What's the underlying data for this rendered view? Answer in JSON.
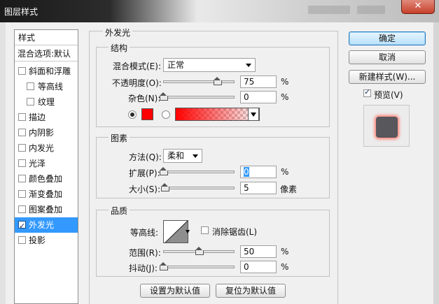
{
  "window": {
    "title": "图层样式",
    "close_label": "✕"
  },
  "style_list": {
    "header": "样式",
    "blend_default": "混合选项:默认",
    "items": [
      {
        "label": "斜面和浮雕",
        "checked": false,
        "indent": false,
        "selected": false
      },
      {
        "label": "等高线",
        "checked": false,
        "indent": true,
        "selected": false
      },
      {
        "label": "纹理",
        "checked": false,
        "indent": true,
        "selected": false
      },
      {
        "label": "描边",
        "checked": false,
        "indent": false,
        "selected": false
      },
      {
        "label": "内阴影",
        "checked": false,
        "indent": false,
        "selected": false
      },
      {
        "label": "内发光",
        "checked": false,
        "indent": false,
        "selected": false
      },
      {
        "label": "光泽",
        "checked": false,
        "indent": false,
        "selected": false
      },
      {
        "label": "颜色叠加",
        "checked": false,
        "indent": false,
        "selected": false
      },
      {
        "label": "渐变叠加",
        "checked": false,
        "indent": false,
        "selected": false
      },
      {
        "label": "图案叠加",
        "checked": false,
        "indent": false,
        "selected": false
      },
      {
        "label": "外发光",
        "checked": true,
        "indent": false,
        "selected": true
      },
      {
        "label": "投影",
        "checked": false,
        "indent": false,
        "selected": false
      }
    ]
  },
  "panel": {
    "title": "外发光",
    "structure": {
      "title": "结构",
      "blend_mode_label": "混合模式(E):",
      "blend_mode_value": "正常",
      "opacity_label": "不透明度(O):",
      "opacity_value": "75",
      "opacity_level": 75,
      "noise_label": "杂色(N):",
      "noise_value": "0",
      "noise_level": 0,
      "unit": "%",
      "glow_color": "#ff0000",
      "color_radio_selected": true
    },
    "elements": {
      "title": "图素",
      "technique_label": "方法(Q):",
      "technique_value": "柔和",
      "spread_label": "扩展(P):",
      "spread_value": "0",
      "spread_level": 0,
      "size_label": "大小(S):",
      "size_value": "5",
      "size_level": 2,
      "size_unit": "像素",
      "unit": "%"
    },
    "quality": {
      "title": "品质",
      "contour_label": "等高线:",
      "anti_alias_label": "消除锯齿(L)",
      "anti_alias_checked": false,
      "range_label": "范围(R):",
      "range_value": "50",
      "range_level": 50,
      "jitter_label": "抖动(J):",
      "jitter_value": "0",
      "jitter_level": 0,
      "unit": "%"
    },
    "make_default_label": "设置为默认值",
    "reset_default_label": "复位为默认值"
  },
  "buttons": {
    "ok": "确定",
    "cancel": "取消",
    "new_style": "新建样式(W)...",
    "preview_label": "预览(V)",
    "preview_checked": true
  },
  "colors": {
    "accent": "#3399ff",
    "glow": "#ff7d6e",
    "preview_fill": "#57575c"
  }
}
